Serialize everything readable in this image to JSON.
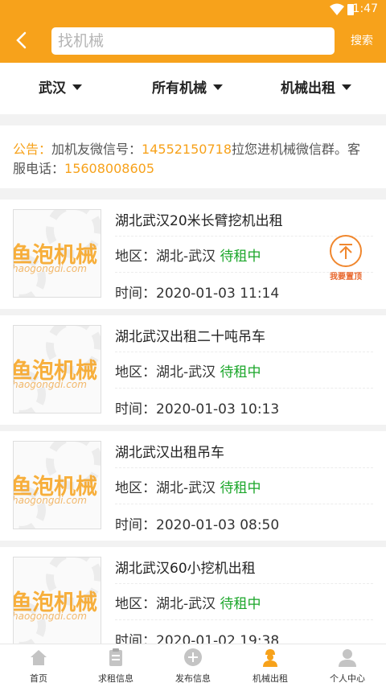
{
  "status": {
    "time": "1:47"
  },
  "header": {
    "search_placeholder": "找机械",
    "search_button": "搜索"
  },
  "filters": [
    {
      "label": "武汉"
    },
    {
      "label": "所有机械"
    },
    {
      "label": "机械出租"
    }
  ],
  "notice": {
    "prefix": "公告：",
    "text1": "加机友微信号：",
    "wechat": "14552150718",
    "text2": "拉您进机械微信群。客服电话：",
    "phone": "15608008605"
  },
  "list": [
    {
      "title": "湖北武汉20米长臂挖机出租",
      "region_label": "地区：",
      "region": "湖北-武汉",
      "status": "待租中",
      "time_label": "时间：",
      "time": "2020-01-03 11:14"
    },
    {
      "title": "湖北武汉出租二十吨吊车",
      "region_label": "地区：",
      "region": "湖北-武汉",
      "status": "待租中",
      "time_label": "时间：",
      "time": "2020-01-03 10:13"
    },
    {
      "title": "湖北武汉出租吊车",
      "region_label": "地区：",
      "region": "湖北-武汉",
      "status": "待租中",
      "time_label": "时间：",
      "time": "2020-01-03 08:50"
    },
    {
      "title": "湖北武汉60小挖机出租",
      "region_label": "地区：",
      "region": "湖北-武汉",
      "status": "待租中",
      "time_label": "时间：",
      "time": "2020-01-02 19:38"
    }
  ],
  "thumb": {
    "brand": "鱼泡机械",
    "site": "haogongdi.com"
  },
  "fab": {
    "label": "我要置顶"
  },
  "tabs": [
    {
      "label": "首页",
      "icon": "home-icon"
    },
    {
      "label": "求租信息",
      "icon": "clipboard-icon"
    },
    {
      "label": "发布信息",
      "icon": "plus-circle-icon"
    },
    {
      "label": "机械出租",
      "icon": "worker-icon"
    },
    {
      "label": "个人中心",
      "icon": "person-icon"
    }
  ],
  "colors": {
    "accent": "#f7a21b",
    "status_green": "#1aa629",
    "fab_red": "#e8672c"
  }
}
